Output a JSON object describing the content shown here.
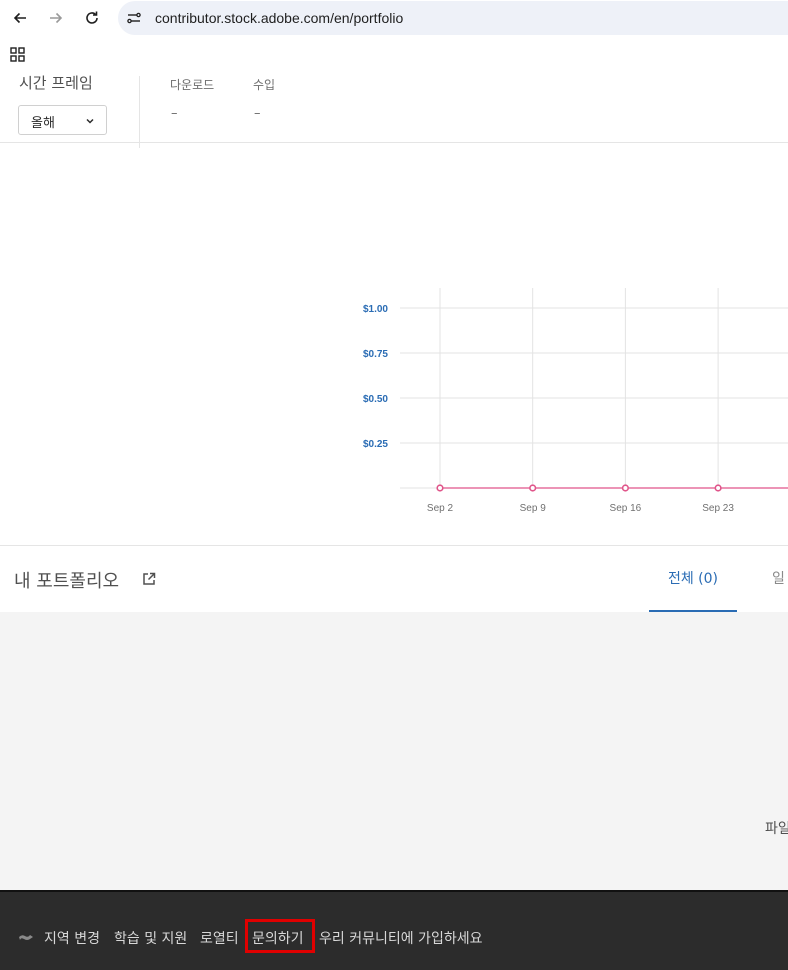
{
  "browser": {
    "url": "contributor.stock.adobe.com/en/portfolio",
    "icons": [
      "back-icon",
      "forward-icon",
      "reload-icon",
      "site-info-icon",
      "apps-icon"
    ]
  },
  "stats": {
    "timeframe_label": "시간 프레임",
    "timeframe_value": "올해",
    "downloads_label": "다운로드",
    "downloads_value": "–",
    "earnings_label": "수입",
    "earnings_value": "–"
  },
  "chart_data": {
    "type": "line",
    "x": [
      "Sep 2",
      "Sep 9",
      "Sep 16",
      "Sep 23"
    ],
    "y_ticks": [
      "$1.00",
      "$0.75",
      "$0.50",
      "$0.25"
    ],
    "series": [
      {
        "values": [
          0,
          0,
          0,
          0,
          0
        ]
      }
    ],
    "ylim": [
      0,
      1
    ],
    "grid": true,
    "colors": {
      "line": "#e0558a",
      "ytick": "#2a6cb4"
    }
  },
  "portfolio": {
    "title": "내 포트폴리오",
    "tab_all": "전체 (0)",
    "tab_next": "일",
    "empty_text": "파일"
  },
  "footer": {
    "region": "지역 변경",
    "learn": "학습 및 지원",
    "royalty": "로열티",
    "contact": "문의하기",
    "community": "우리 커뮤니티에 가입하세요"
  }
}
